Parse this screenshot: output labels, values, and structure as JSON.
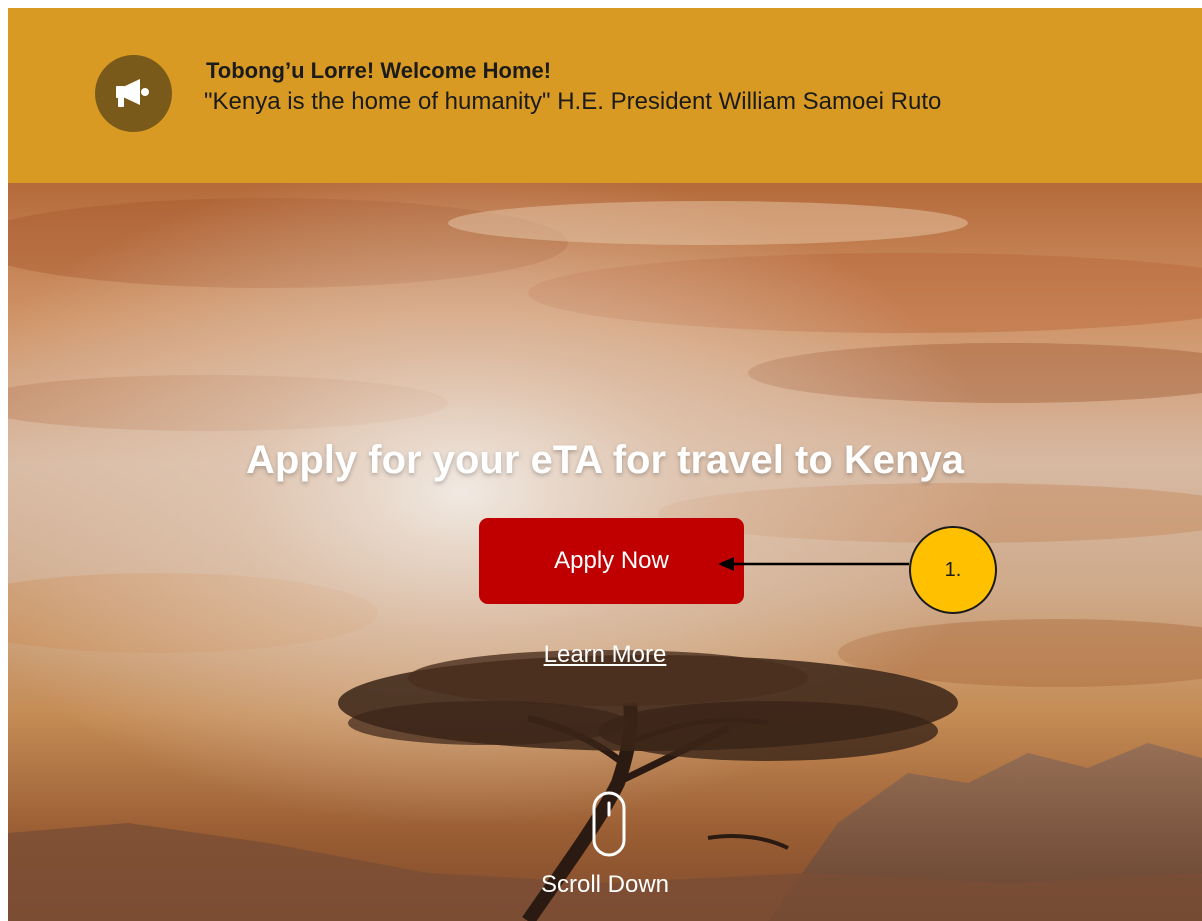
{
  "banner": {
    "title": "Tobong’u Lorre! Welcome Home!",
    "quote": "\"Kenya is the home of humanity\" H.E. President William Samoei Ruto",
    "icon": "megaphone-icon",
    "background_color": "#D89A22"
  },
  "hero": {
    "headline": "Apply for your eTA for travel to Kenya",
    "apply_button_label": "Apply Now",
    "learn_more_label": "Learn More",
    "scroll_label": "Scroll Down",
    "scroll_icon": "mouse-icon",
    "apply_button_color": "#C00000"
  },
  "annotation": {
    "callout_label": "1.",
    "callout_color": "#FFC000"
  }
}
